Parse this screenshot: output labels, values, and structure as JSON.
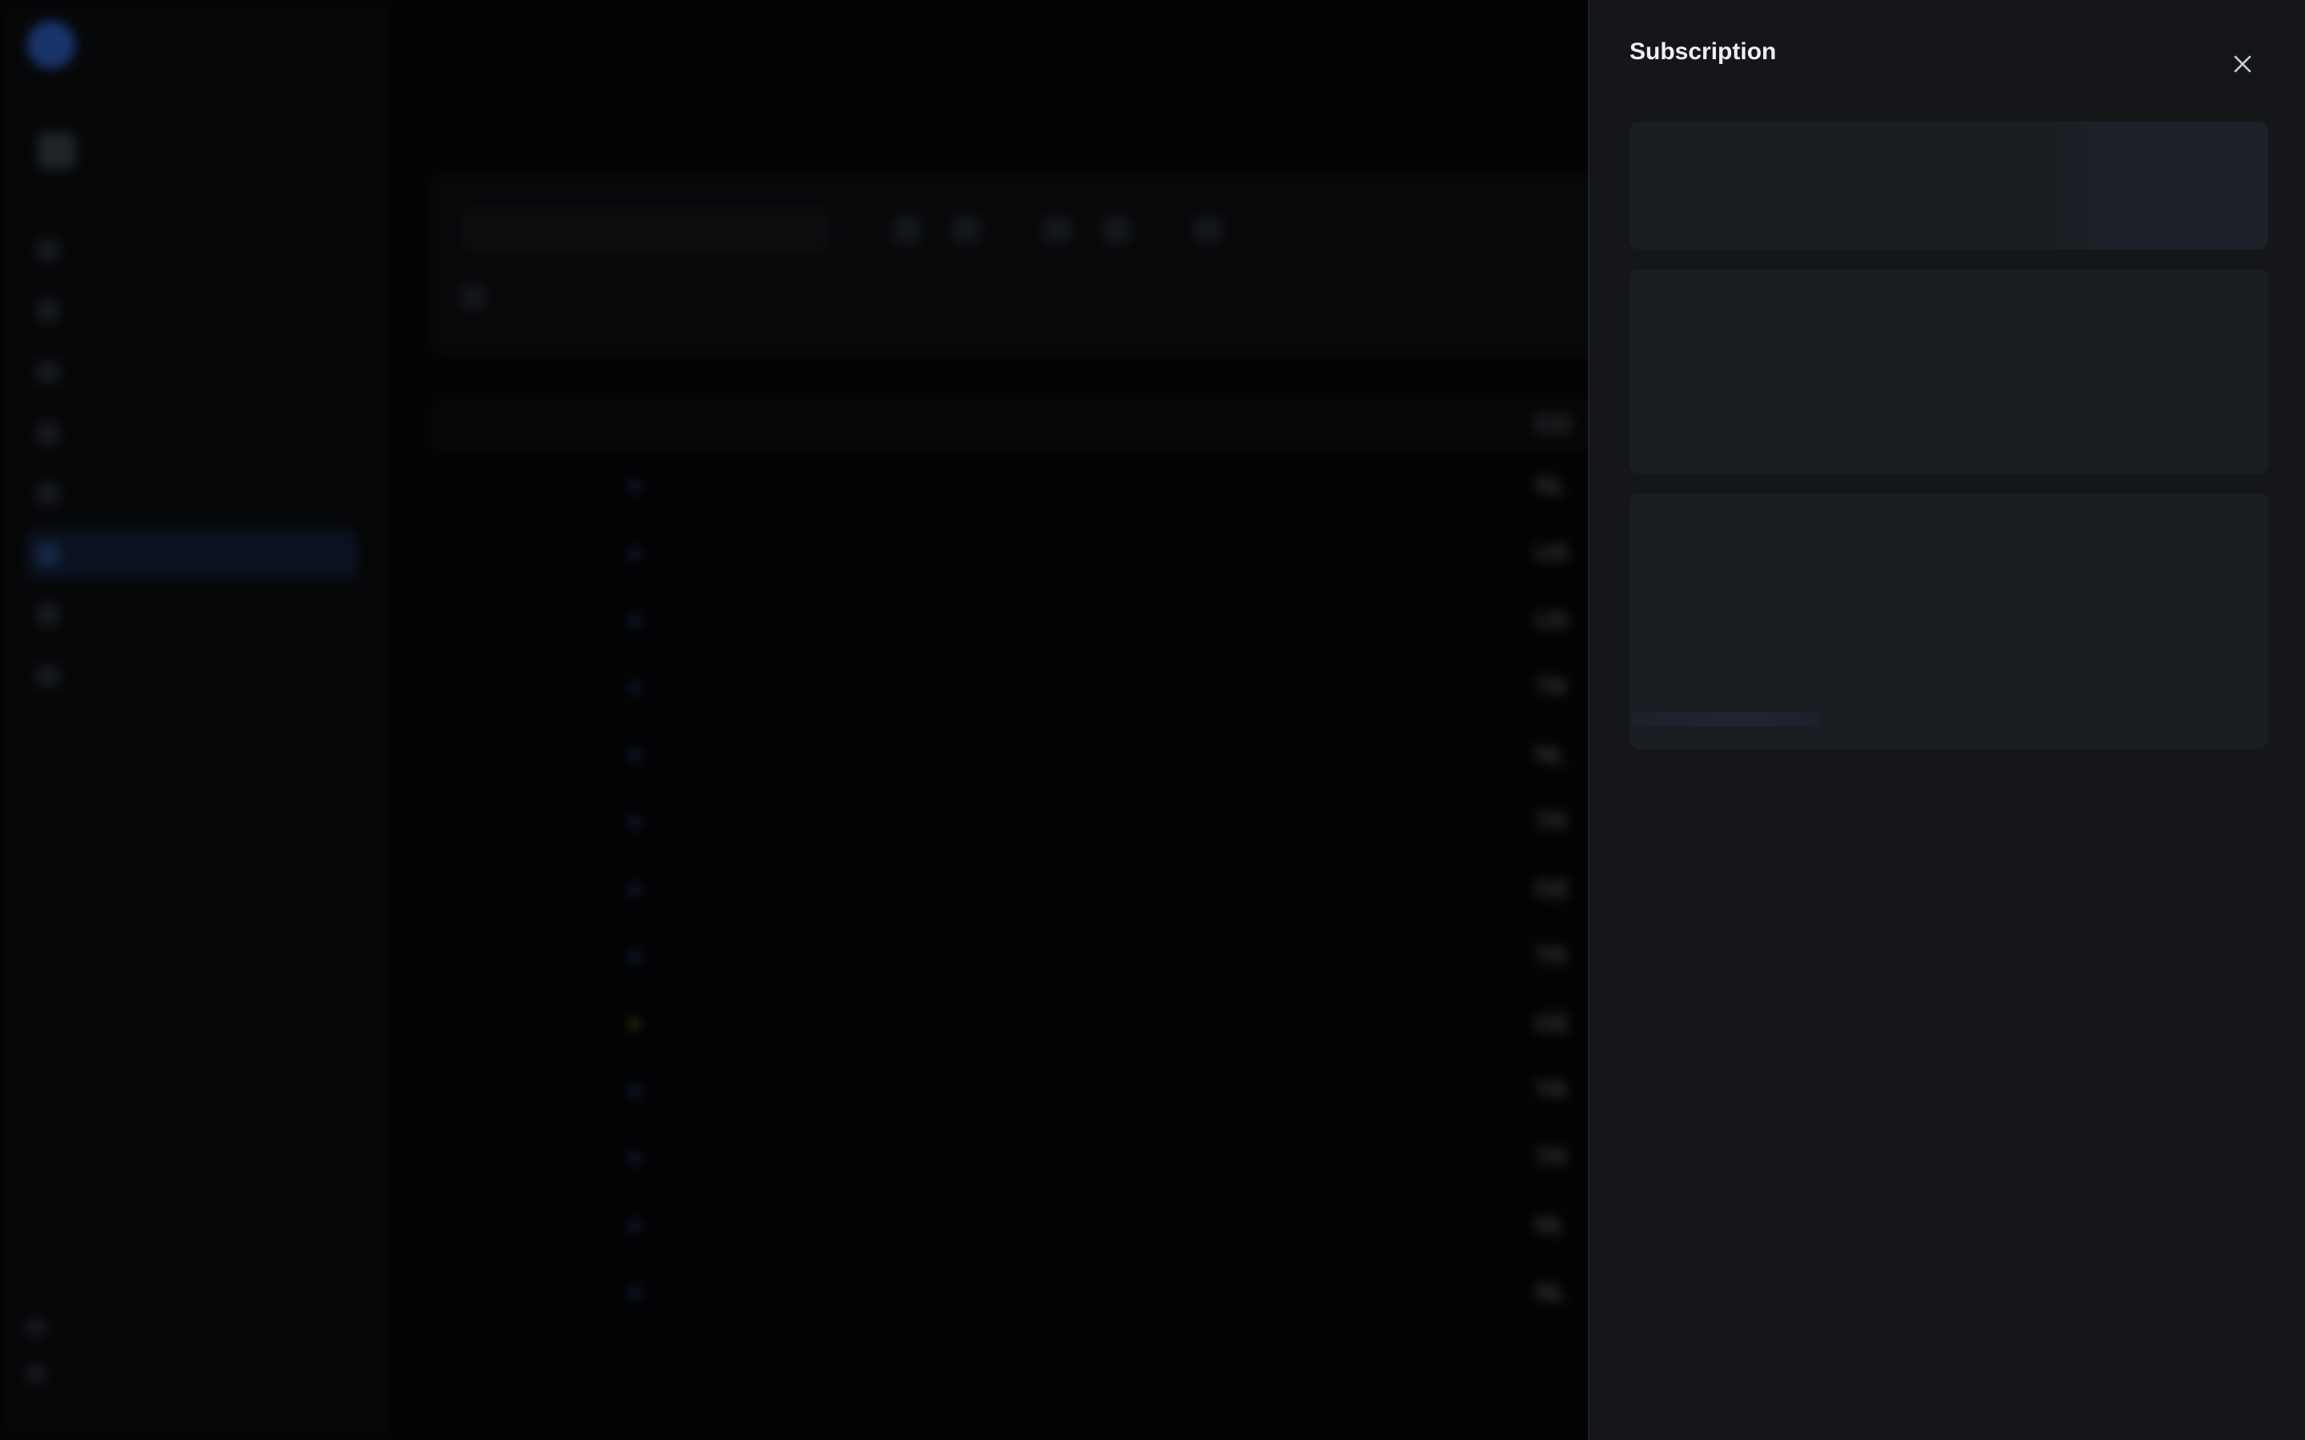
{
  "app": {
    "brand": {
      "name": ""
    },
    "sidebar": {
      "section_label": "",
      "org": {
        "name": "",
        "role": ""
      },
      "items": [
        {
          "label": ""
        },
        {
          "label": ""
        },
        {
          "label": ""
        },
        {
          "label": ""
        },
        {
          "label": ""
        },
        {
          "label": "",
          "active": true
        },
        {
          "label": ""
        },
        {
          "label": ""
        }
      ],
      "footer": {
        "title": "",
        "subtitle": "",
        "links": [
          "",
          ""
        ]
      }
    },
    "main": {
      "breadcrumbs": [
        "",
        "",
        ""
      ],
      "page_title": "",
      "page_subtitle": "",
      "filters": {
        "search_placeholder": "",
        "chips": [
          "",
          "",
          ""
        ],
        "clear_label": ""
      },
      "table": {
        "columns": [
          "",
          "",
          "",
          "CO"
        ],
        "rows": [
          {
            "c4": "NL"
          },
          {
            "c4": "US"
          },
          {
            "c4": "US"
          },
          {
            "c4": "TR"
          },
          {
            "c4": "NL"
          },
          {
            "c4": "TR"
          },
          {
            "c4": "GE"
          },
          {
            "c4": "TR"
          },
          {
            "c4": "GE"
          },
          {
            "c4": "TR"
          },
          {
            "c4": "TR"
          },
          {
            "c4": "NL"
          },
          {
            "c4": "NL"
          }
        ]
      }
    }
  },
  "drawer": {
    "title": "Subscription",
    "close_icon": "close-icon",
    "loading": true
  },
  "colors": {
    "drawer_bg": "#141619",
    "skeleton": "#1a1d21",
    "accent": "#2f5fc4"
  }
}
